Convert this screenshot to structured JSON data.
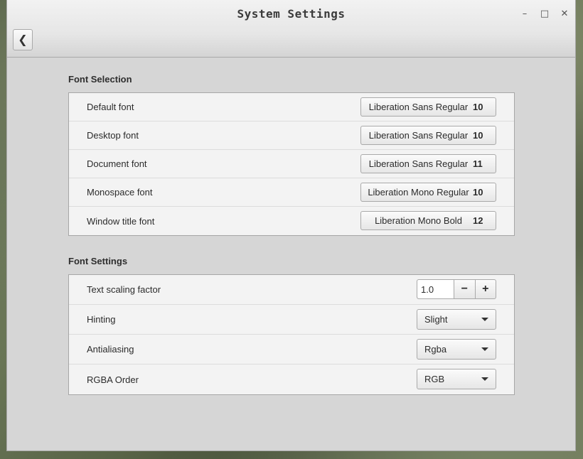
{
  "window": {
    "title": "System Settings",
    "controls": {
      "minimize": "–",
      "maximize": "□",
      "close": "✕"
    },
    "back_icon": "❮"
  },
  "font_selection": {
    "title": "Font Selection",
    "rows": [
      {
        "label": "Default font",
        "font": "Liberation Sans Regular",
        "size": "10"
      },
      {
        "label": "Desktop font",
        "font": "Liberation Sans Regular",
        "size": "10"
      },
      {
        "label": "Document font",
        "font": "Liberation Sans Regular",
        "size": "11"
      },
      {
        "label": "Monospace font",
        "font": "Liberation Mono Regular",
        "size": "10"
      },
      {
        "label": "Window title font",
        "font": "Liberation Mono Bold",
        "size": "12"
      }
    ]
  },
  "font_settings": {
    "title": "Font Settings",
    "scaling": {
      "label": "Text scaling factor",
      "value": "1.0",
      "minus": "−",
      "plus": "+"
    },
    "hinting": {
      "label": "Hinting",
      "value": "Slight"
    },
    "antialiasing": {
      "label": "Antialiasing",
      "value": "Rgba"
    },
    "rgba_order": {
      "label": "RGBA Order",
      "value": "RGB"
    }
  },
  "icons": [
    "back-icon",
    "minimize-icon",
    "maximize-icon",
    "close-icon",
    "dropdown-arrow-icon",
    "minus-icon",
    "plus-icon"
  ]
}
